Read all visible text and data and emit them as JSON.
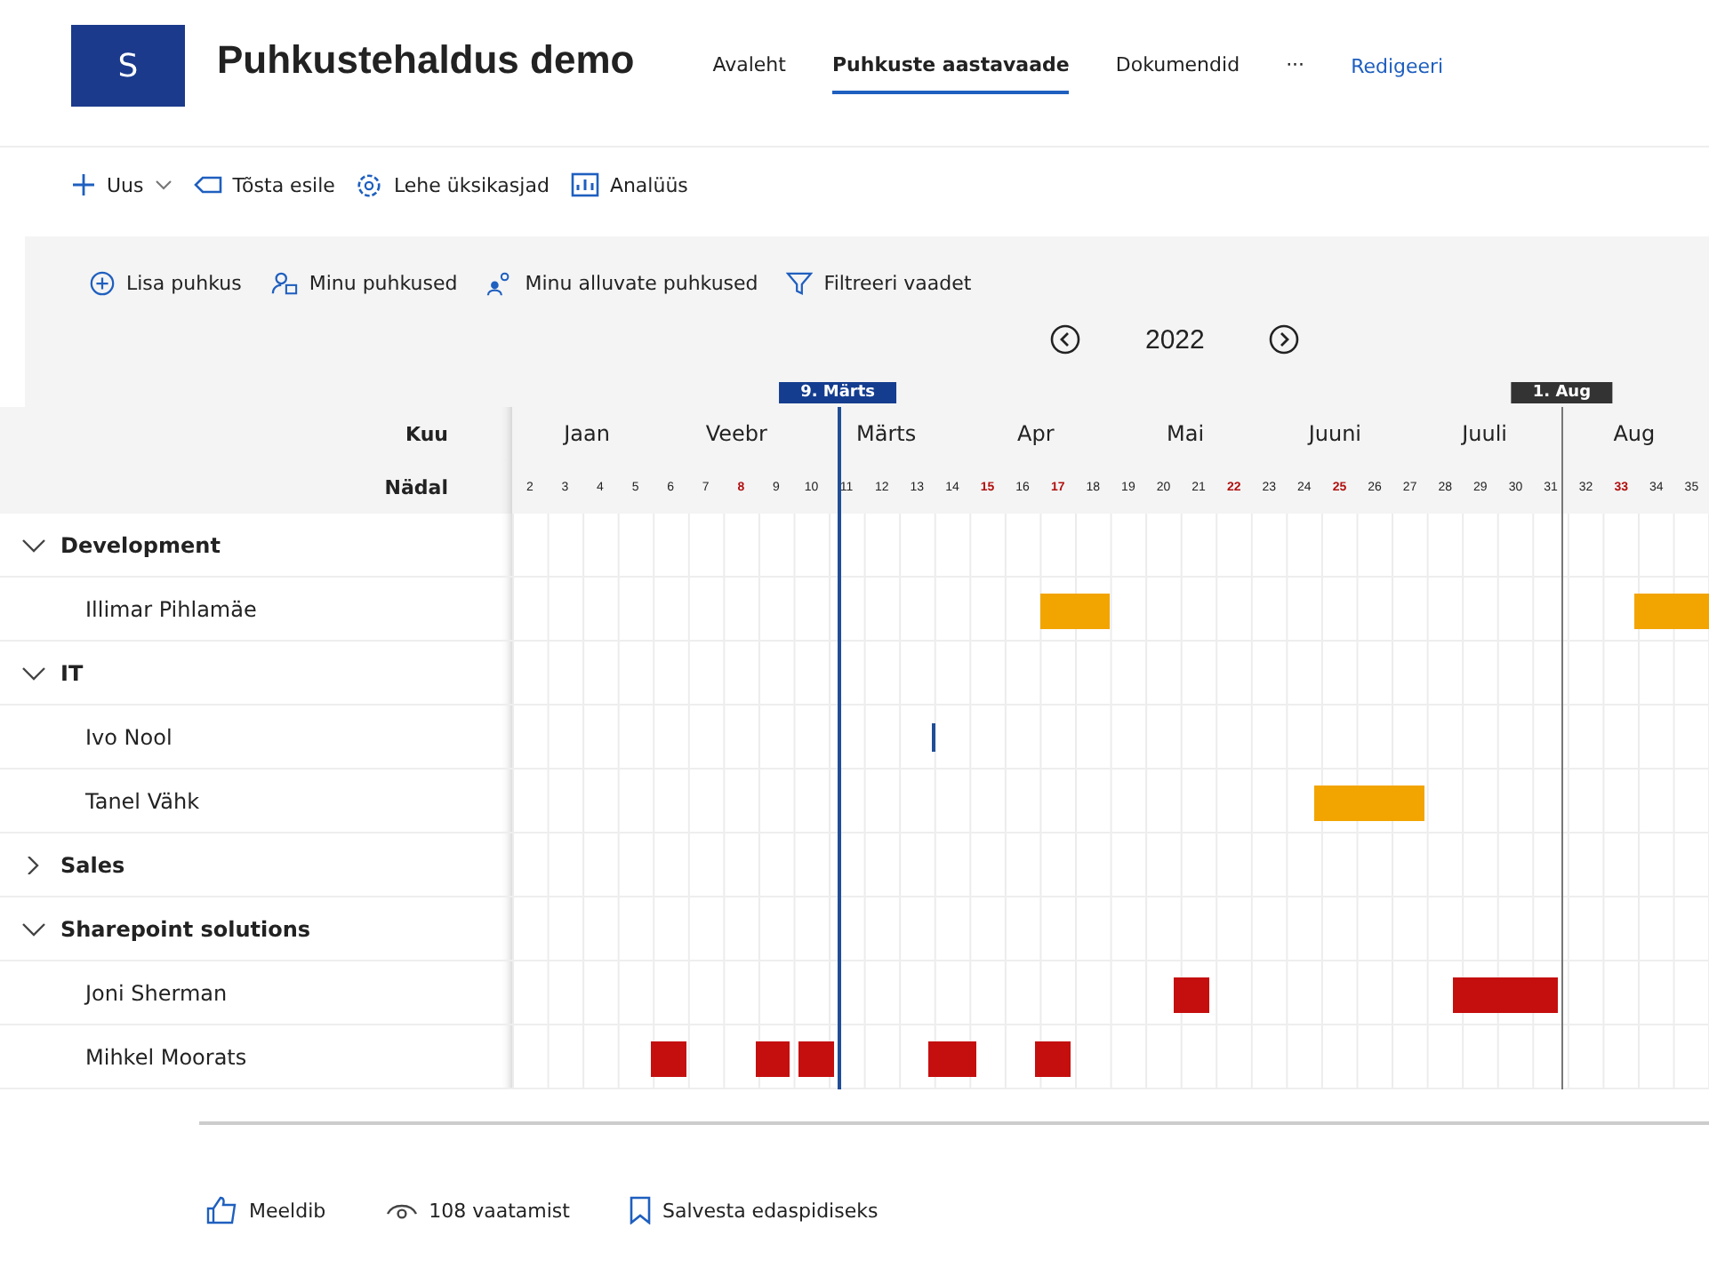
{
  "site": {
    "logo": "S",
    "title": "Puhkustehaldus demo"
  },
  "nav": [
    {
      "label": "Avaleht",
      "selected": false
    },
    {
      "label": "Puhkuste aastavaade",
      "selected": true
    },
    {
      "label": "Dokumendid",
      "selected": false
    }
  ],
  "nav_more": "···",
  "edit_link": "Redigeeri",
  "toolbar": [
    {
      "kind": "new",
      "label": "Uus"
    },
    {
      "kind": "promote",
      "label": "Tõsta esile"
    },
    {
      "kind": "details",
      "label": "Lehe üksikasjad"
    },
    {
      "kind": "analytics",
      "label": "Analüüs"
    }
  ],
  "commands": [
    {
      "kind": "add",
      "label": "Lisa puhkus"
    },
    {
      "kind": "mine",
      "label": "Minu puhkused"
    },
    {
      "kind": "team",
      "label": "Minu alluvate puhkused"
    },
    {
      "kind": "filter",
      "label": "Filtreeri vaadet"
    }
  ],
  "year": "2022",
  "markers": [
    {
      "kind": "today",
      "label": "9. Märts"
    },
    {
      "kind": "month",
      "label": "1. Aug"
    }
  ],
  "header": {
    "month_label": "Kuu",
    "week_label": "Nädal"
  },
  "months": [
    "Jaan",
    "Veebr",
    "Märts",
    "Apr",
    "Mai",
    "Juuni",
    "Juuli",
    "Aug"
  ],
  "weeks": [
    {
      "n": "2",
      "holiday": false
    },
    {
      "n": "3",
      "holiday": false
    },
    {
      "n": "4",
      "holiday": false
    },
    {
      "n": "5",
      "holiday": false
    },
    {
      "n": "6",
      "holiday": false
    },
    {
      "n": "7",
      "holiday": false
    },
    {
      "n": "8",
      "holiday": true
    },
    {
      "n": "9",
      "holiday": false
    },
    {
      "n": "10",
      "holiday": false
    },
    {
      "n": "11",
      "holiday": false
    },
    {
      "n": "12",
      "holiday": false
    },
    {
      "n": "13",
      "holiday": false
    },
    {
      "n": "14",
      "holiday": false
    },
    {
      "n": "15",
      "holiday": true
    },
    {
      "n": "16",
      "holiday": false
    },
    {
      "n": "17",
      "holiday": true
    },
    {
      "n": "18",
      "holiday": false
    },
    {
      "n": "19",
      "holiday": false
    },
    {
      "n": "20",
      "holiday": false
    },
    {
      "n": "21",
      "holiday": false
    },
    {
      "n": "22",
      "holiday": true
    },
    {
      "n": "23",
      "holiday": false
    },
    {
      "n": "24",
      "holiday": false
    },
    {
      "n": "25",
      "holiday": true
    },
    {
      "n": "26",
      "holiday": false
    },
    {
      "n": "27",
      "holiday": false
    },
    {
      "n": "28",
      "holiday": false
    },
    {
      "n": "29",
      "holiday": false
    },
    {
      "n": "30",
      "holiday": false
    },
    {
      "n": "31",
      "holiday": false
    },
    {
      "n": "32",
      "holiday": false
    },
    {
      "n": "33",
      "holiday": true
    },
    {
      "n": "34",
      "holiday": false
    },
    {
      "n": "35",
      "holiday": false
    }
  ],
  "groups": [
    {
      "name": "Development",
      "expanded": true,
      "members": [
        {
          "name": "Illimar Pihlamäe",
          "leaves": [
            {
              "kind": "bar",
              "color": "#f2a500"
            },
            {
              "kind": "bar",
              "color": "#f2a500"
            }
          ]
        }
      ]
    },
    {
      "name": "IT",
      "expanded": true,
      "members": [
        {
          "name": "Ivo Nool",
          "leaves": [
            {
              "kind": "line",
              "color": "#1f4e96"
            }
          ]
        },
        {
          "name": "Tanel Vähk",
          "leaves": [
            {
              "kind": "bar",
              "color": "#f2a500"
            }
          ]
        }
      ]
    },
    {
      "name": "Sales",
      "expanded": false
    },
    {
      "name": "Sharepoint solutions",
      "expanded": true,
      "members": [
        {
          "name": "Joni Sherman",
          "leaves": [
            {
              "kind": "bar",
              "color": "#c50f0f"
            },
            {
              "kind": "bar",
              "color": "#c50f0f"
            }
          ]
        },
        {
          "name": "Mihkel Moorats",
          "leaves": [
            {
              "kind": "bar",
              "color": "#c50f0f"
            },
            {
              "kind": "bar",
              "color": "#c50f0f"
            },
            {
              "kind": "bar",
              "color": "#c50f0f"
            },
            {
              "kind": "bar",
              "color": "#c50f0f"
            },
            {
              "kind": "bar",
              "color": "#c50f0f"
            }
          ]
        }
      ]
    }
  ],
  "footer": [
    {
      "kind": "like",
      "label": "Meeldib"
    },
    {
      "kind": "views",
      "label": "108 vaatamist"
    },
    {
      "kind": "save",
      "label": "Salvesta edaspidiseks"
    }
  ]
}
